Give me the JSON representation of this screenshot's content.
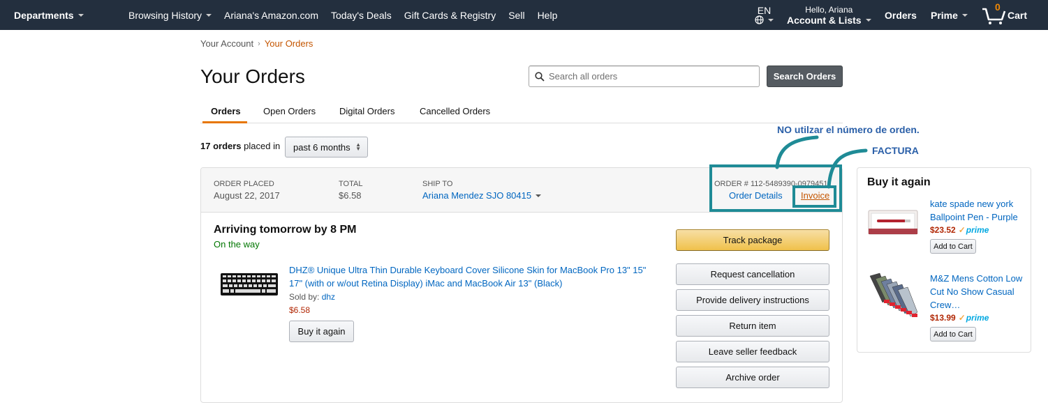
{
  "nav": {
    "departments": "Departments",
    "links": [
      "Browsing History",
      "Ariana's Amazon.com",
      "Today's Deals",
      "Gift Cards & Registry",
      "Sell",
      "Help"
    ],
    "language": "EN",
    "greeting": "Hello, Ariana",
    "account": "Account & Lists",
    "orders": "Orders",
    "prime": "Prime",
    "cart_count": "0",
    "cart": "Cart"
  },
  "breadcrumb": {
    "parent": "Your Account",
    "separator": "›",
    "current": "Your Orders"
  },
  "page_title": "Your Orders",
  "search": {
    "placeholder": "Search all orders",
    "button": "Search Orders"
  },
  "tabs": [
    "Orders",
    "Open Orders",
    "Digital Orders",
    "Cancelled Orders"
  ],
  "summary": {
    "count": "17 orders",
    "placed_in": "placed in",
    "range": "past 6 months"
  },
  "order": {
    "placed_label": "ORDER PLACED",
    "placed_value": "August 22, 2017",
    "total_label": "TOTAL",
    "total_value": "$6.58",
    "ship_label": "SHIP TO",
    "ship_value": "Ariana Mendez SJO 80415",
    "order_number": "ORDER # 112-5489390-0979451",
    "details_link": "Order Details",
    "invoice_link": "Invoice",
    "arriving": "Arriving tomorrow by 8 PM",
    "status": "On the way",
    "product_title": "DHZ® Unique Ultra Thin Durable Keyboard Cover Silicone Skin for MacBook Pro 13\" 15\" 17\" (with or w/out Retina Display) iMac and MacBook Air 13\" (Black)",
    "sold_by_label": "Sold by:",
    "seller": "dhz",
    "price": "$6.58",
    "buy_again": "Buy it again",
    "actions": [
      "Track package",
      "Request cancellation",
      "Provide delivery instructions",
      "Return item",
      "Leave seller feedback",
      "Archive order"
    ]
  },
  "buy_again_panel": {
    "title": "Buy it again",
    "items": [
      {
        "name": "kate spade new york Ballpoint Pen - Purple",
        "price": "$23.52",
        "prime": "prime",
        "button": "Add to Cart"
      },
      {
        "name": "M&Z Mens Cotton Low Cut No Show Casual Crew…",
        "price": "$13.99",
        "prime": "prime",
        "button": "Add to Cart"
      }
    ]
  },
  "annotations": {
    "note_order_number": "NO utilzar el número de orden.",
    "note_invoice": "FACTURA",
    "color": "#1f8b96"
  }
}
